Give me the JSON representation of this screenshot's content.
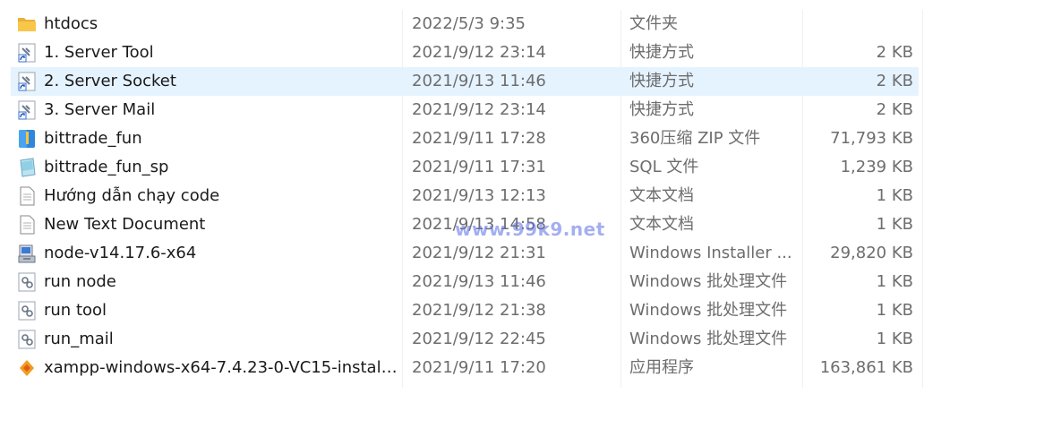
{
  "files": [
    {
      "name": "htdocs",
      "date": "2022/5/3 9:35",
      "type": "文件夹",
      "size": "",
      "icon": "folder-icon",
      "selected": false
    },
    {
      "name": "1. Server Tool",
      "date": "2021/9/12 23:14",
      "type": "快捷方式",
      "size": "2 KB",
      "icon": "shortcut-icon",
      "selected": false
    },
    {
      "name": "2. Server Socket",
      "date": "2021/9/13 11:46",
      "type": "快捷方式",
      "size": "2 KB",
      "icon": "shortcut-icon",
      "selected": true
    },
    {
      "name": "3. Server Mail",
      "date": "2021/9/12 23:14",
      "type": "快捷方式",
      "size": "2 KB",
      "icon": "shortcut-icon",
      "selected": false
    },
    {
      "name": "bittrade_fun",
      "date": "2021/9/11 17:28",
      "type": "360压缩 ZIP 文件",
      "size": "71,793 KB",
      "icon": "zip-archive-icon",
      "selected": false
    },
    {
      "name": "bittrade_fun_sp",
      "date": "2021/9/11 17:31",
      "type": "SQL 文件",
      "size": "1,239 KB",
      "icon": "sql-file-icon",
      "selected": false
    },
    {
      "name": "Hướng dẫn chạy code",
      "date": "2021/9/13 12:13",
      "type": "文本文档",
      "size": "1 KB",
      "icon": "text-document-icon",
      "selected": false
    },
    {
      "name": "New Text Document",
      "date": "2021/9/13 14:58",
      "type": "文本文档",
      "size": "1 KB",
      "icon": "text-document-icon",
      "selected": false
    },
    {
      "name": "node-v14.17.6-x64",
      "date": "2021/9/12 21:31",
      "type": "Windows Installer ...",
      "size": "29,820 KB",
      "icon": "installer-icon",
      "selected": false
    },
    {
      "name": "run node",
      "date": "2021/9/13 11:46",
      "type": "Windows 批处理文件",
      "size": "1 KB",
      "icon": "batch-file-icon",
      "selected": false
    },
    {
      "name": "run tool",
      "date": "2021/9/12 21:38",
      "type": "Windows 批处理文件",
      "size": "1 KB",
      "icon": "batch-file-icon",
      "selected": false
    },
    {
      "name": "run_mail",
      "date": "2021/9/12 22:45",
      "type": "Windows 批处理文件",
      "size": "1 KB",
      "icon": "batch-file-icon",
      "selected": false
    },
    {
      "name": "xampp-windows-x64-7.4.23-0-VC15-install...",
      "date": "2021/9/11 17:20",
      "type": "应用程序",
      "size": "163,861 KB",
      "icon": "application-icon",
      "selected": false
    }
  ],
  "watermark": "www.99k9.net",
  "colors": {
    "selection": "#e5f3ff",
    "folder": "#f8c74a",
    "secondary_text": "#6d6d6d",
    "watermark": "#5a6ee6"
  }
}
